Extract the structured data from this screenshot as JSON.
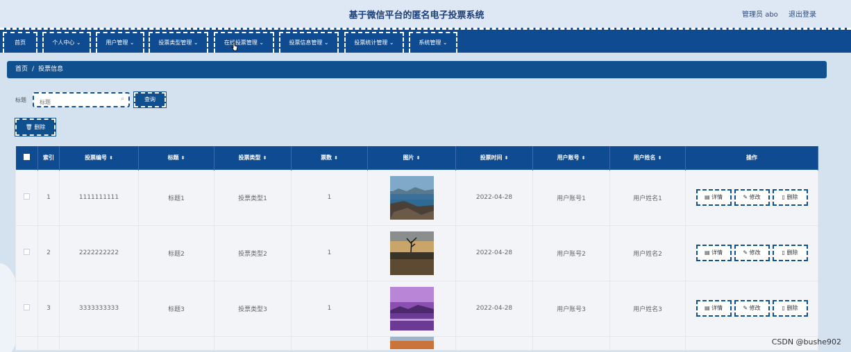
{
  "header": {
    "title": "基于微信平台的匿名电子投票系统",
    "user": "管理员 abo",
    "logout": "退出登录"
  },
  "nav": [
    "首页",
    "个人中心",
    "用户管理",
    "投票类型管理",
    "在线投票管理",
    "投票信息管理",
    "投票统计管理",
    "系统管理"
  ],
  "breadcrumb": {
    "home": "首页",
    "sep": "/",
    "current": "投票信息"
  },
  "search": {
    "label": "标题",
    "placeholder": "标题",
    "button": "查询"
  },
  "toolbar": {
    "delete": "删除"
  },
  "table": {
    "columns": {
      "index": "索引",
      "vote_no": "投票编号",
      "title": "标题",
      "vote_type": "投票类型",
      "votes": "票数",
      "image": "图片",
      "vote_time": "投票时间",
      "account": "用户账号",
      "name": "用户姓名",
      "ops": "操作"
    },
    "rows": [
      {
        "index": "1",
        "vote_no": "1111111111",
        "title": "标题1",
        "vote_type": "投票类型1",
        "votes": "1",
        "vote_time": "2022-04-28",
        "account": "用户账号1",
        "name": "用户姓名1"
      },
      {
        "index": "2",
        "vote_no": "2222222222",
        "title": "标题2",
        "vote_type": "投票类型2",
        "votes": "1",
        "vote_time": "2022-04-28",
        "account": "用户账号2",
        "name": "用户姓名2"
      },
      {
        "index": "3",
        "vote_no": "3333333333",
        "title": "标题3",
        "vote_type": "投票类型3",
        "votes": "1",
        "vote_time": "2022-04-28",
        "account": "用户账号3",
        "name": "用户姓名3"
      }
    ],
    "actions": {
      "detail": "详情",
      "edit": "修改",
      "delete": "删除"
    }
  },
  "watermark": "CSDN @bushe902",
  "colors": {
    "primary": "#0f4b91",
    "background": "#d4e2f0",
    "header": "#dde8f4"
  }
}
